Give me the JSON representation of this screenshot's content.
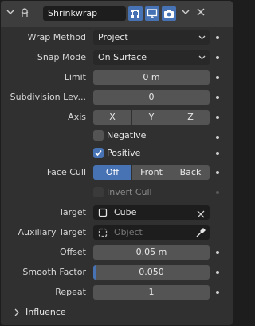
{
  "header": {
    "modifier_name": "Shrinkwrap",
    "expand_icon": "chevron-down-icon",
    "modifier_icon": "shrinkwrap-icon",
    "toggles": [
      "edit-mode-icon",
      "viewport-icon",
      "render-icon"
    ],
    "menu_icon": "chevron-down-icon",
    "close_icon": "close-icon"
  },
  "fields": {
    "wrap_method": {
      "label": "Wrap Method",
      "value": "Project"
    },
    "snap_mode": {
      "label": "Snap Mode",
      "value": "On Surface"
    },
    "limit": {
      "label": "Limit",
      "value": "0 m"
    },
    "subdivision": {
      "label": "Subdivision Lev...",
      "value": "0"
    },
    "axis": {
      "label": "Axis",
      "options": [
        "X",
        "Y",
        "Z"
      ]
    },
    "negative": {
      "label": "Negative",
      "checked": false
    },
    "positive": {
      "label": "Positive",
      "checked": true
    },
    "face_cull": {
      "label": "Face Cull",
      "options": [
        "Off",
        "Front",
        "Back"
      ],
      "selected": "Off"
    },
    "invert_cull": {
      "label": "Invert Cull",
      "checked": false,
      "enabled": false
    },
    "target": {
      "label": "Target",
      "value": "Cube"
    },
    "aux_target": {
      "label": "Auxiliary Target",
      "placeholder": "Object"
    },
    "offset": {
      "label": "Offset",
      "value": "0.05 m"
    },
    "smooth_factor": {
      "label": "Smooth Factor",
      "value": "0.050",
      "fraction": 0.05
    },
    "repeat": {
      "label": "Repeat",
      "value": "1"
    }
  },
  "influence": {
    "label": "Influence"
  },
  "colors": {
    "accent": "#4772b3",
    "panel": "#303030",
    "header": "#3d3d3d",
    "field": "#545454",
    "dropdown": "#282828"
  }
}
